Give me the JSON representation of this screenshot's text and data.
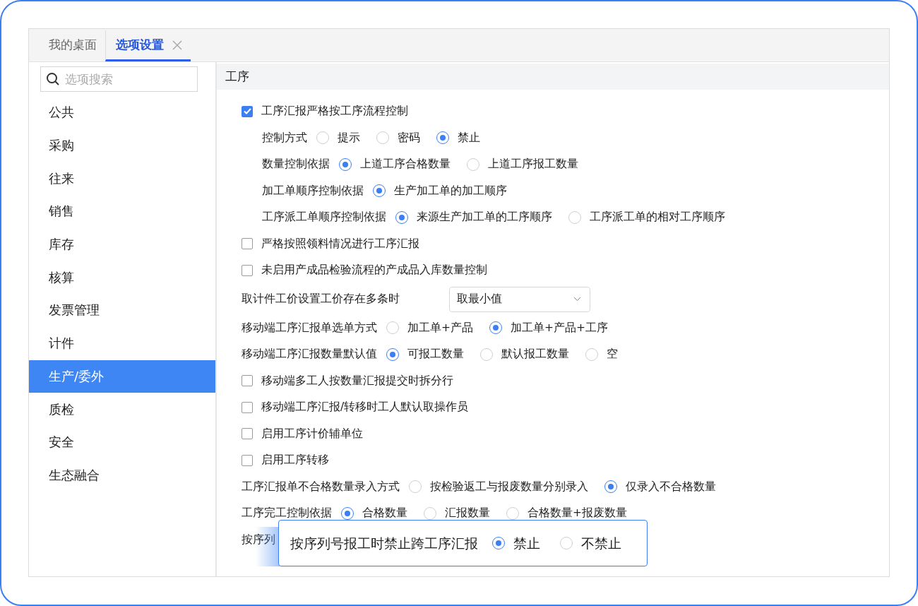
{
  "tabs": [
    {
      "label": "我的桌面",
      "selected": false,
      "closable": false
    },
    {
      "label": "选项设置",
      "selected": true,
      "closable": true
    }
  ],
  "search": {
    "placeholder": "选项搜索"
  },
  "sidebar": {
    "items": [
      {
        "label": "公共",
        "selected": false
      },
      {
        "label": "采购",
        "selected": false
      },
      {
        "label": "往来",
        "selected": false
      },
      {
        "label": "销售",
        "selected": false
      },
      {
        "label": "库存",
        "selected": false
      },
      {
        "label": "核算",
        "selected": false
      },
      {
        "label": "发票管理",
        "selected": false
      },
      {
        "label": "计件",
        "selected": false
      },
      {
        "label": "生产/委外",
        "selected": true
      },
      {
        "label": "质检",
        "selected": false
      },
      {
        "label": "安全",
        "selected": false
      },
      {
        "label": "生态融合",
        "selected": false
      }
    ]
  },
  "section": {
    "title": "工序",
    "rows": [
      {
        "kind": "checkbox",
        "label": "工序汇报严格按工序流程控制",
        "checked": true,
        "children": [
          {
            "kind": "radio",
            "label": "控制方式",
            "options": [
              {
                "label": "提示",
                "selected": false
              },
              {
                "label": "密码",
                "selected": false
              },
              {
                "label": "禁止",
                "selected": true
              }
            ]
          },
          {
            "kind": "radio",
            "label": "数量控制依据",
            "options": [
              {
                "label": "上道工序合格数量",
                "selected": true
              },
              {
                "label": "上道工序报工数量",
                "selected": false
              }
            ]
          },
          {
            "kind": "radio",
            "label": "加工单顺序控制依据",
            "options": [
              {
                "label": "生产加工单的加工顺序",
                "selected": true
              }
            ]
          },
          {
            "kind": "radio",
            "label": "工序派工单顺序控制依据",
            "options": [
              {
                "label": "来源生产加工单的工序顺序",
                "selected": true
              },
              {
                "label": "工序派工单的相对工序顺序",
                "selected": false
              }
            ]
          }
        ]
      },
      {
        "kind": "checkbox",
        "label": "严格按照领料情况进行工序汇报",
        "checked": false
      },
      {
        "kind": "checkbox",
        "label": "未启用产成品检验流程的产成品入库数量控制",
        "checked": false
      },
      {
        "kind": "select",
        "label": "取计件工价设置工价存在多条时",
        "value": "取最小值"
      },
      {
        "kind": "radio",
        "label": "移动端工序汇报单选单方式",
        "options": [
          {
            "label": "加工单+产品",
            "selected": false
          },
          {
            "label": "加工单+产品+工序",
            "selected": true
          }
        ]
      },
      {
        "kind": "radio",
        "label": "移动端工序汇报数量默认值",
        "options": [
          {
            "label": "可报工数量",
            "selected": true
          },
          {
            "label": "默认报工数量",
            "selected": false
          },
          {
            "label": "空",
            "selected": false
          }
        ]
      },
      {
        "kind": "checkbox",
        "label": "移动端多工人按数量汇报提交时拆分行",
        "checked": false
      },
      {
        "kind": "checkbox",
        "label": "移动端工序汇报/转移时工人默认取操作员",
        "checked": false
      },
      {
        "kind": "checkbox",
        "label": "启用工序计价辅单位",
        "checked": false
      },
      {
        "kind": "checkbox",
        "label": "启用工序转移",
        "checked": false
      },
      {
        "kind": "radio",
        "label": "工序汇报单不合格数量录入方式",
        "options": [
          {
            "label": "按检验返工与报废数量分别录入",
            "selected": false
          },
          {
            "label": "仅录入不合格数量",
            "selected": true
          }
        ]
      },
      {
        "kind": "radio",
        "label": "工序完工控制依据",
        "options": [
          {
            "label": "合格数量",
            "selected": true
          },
          {
            "label": "汇报数量",
            "selected": false
          },
          {
            "label": "合格数量+报废数量",
            "selected": false
          }
        ]
      },
      {
        "kind": "radio",
        "label": "按序列"
      }
    ]
  },
  "callout": {
    "label": "按序列号报工时禁止跨工序汇报",
    "options": [
      {
        "label": "禁止",
        "selected": true
      },
      {
        "label": "不禁止",
        "selected": false
      }
    ]
  }
}
